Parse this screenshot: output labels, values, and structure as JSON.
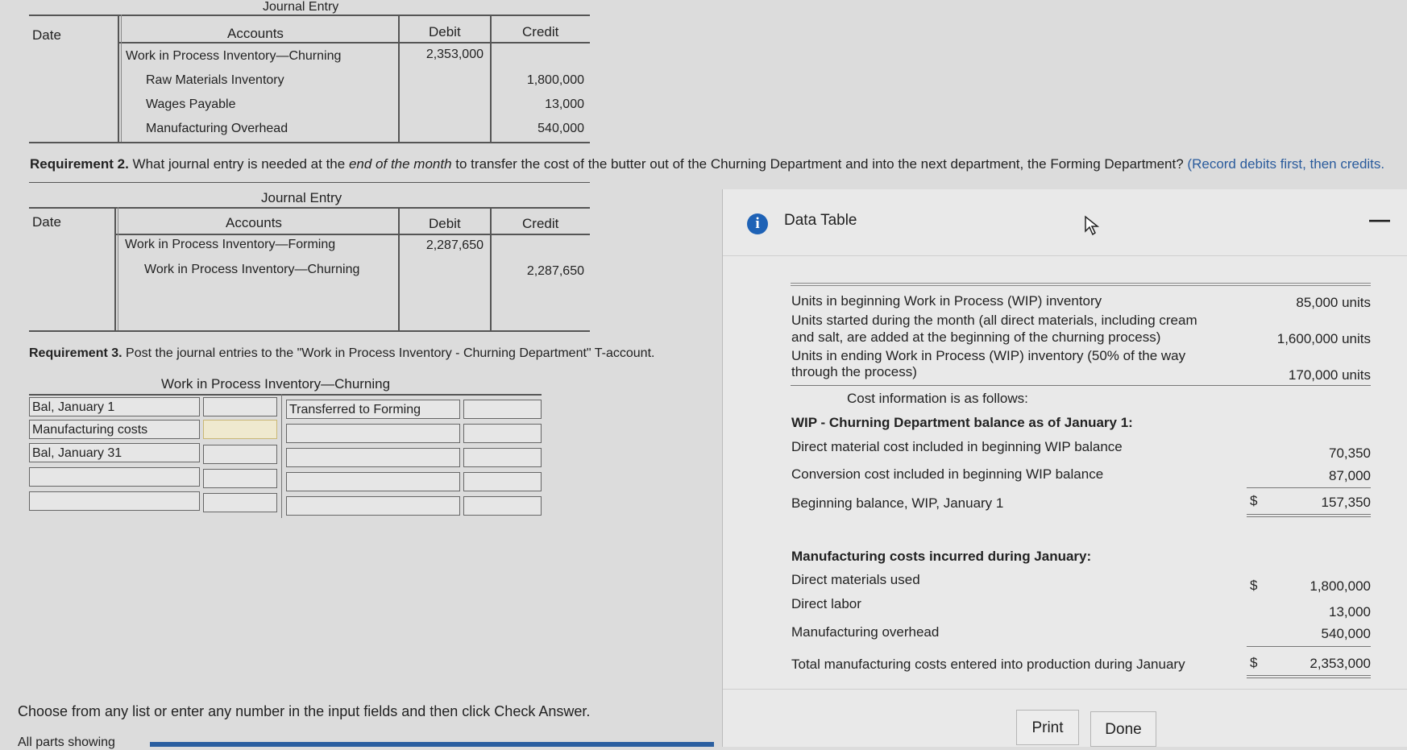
{
  "journal1": {
    "title": "Journal Entry",
    "headers": {
      "date": "Date",
      "accounts": "Accounts",
      "debit": "Debit",
      "credit": "Credit"
    },
    "rows": [
      {
        "account": "Work in Process Inventory—Churning",
        "debit": "2,353,000",
        "credit": ""
      },
      {
        "account": "Raw Materials Inventory",
        "debit": "",
        "credit": "1,800,000"
      },
      {
        "account": "Wages Payable",
        "debit": "",
        "credit": "13,000"
      },
      {
        "account": "Manufacturing Overhead",
        "debit": "",
        "credit": "540,000"
      }
    ]
  },
  "req2": {
    "label": "Requirement 2.",
    "text_a": "What journal entry is needed at the",
    "text_italic": "end of the month",
    "text_b": "to transfer the cost of the butter out of the Churning Department and into the next department, the Forming Department?",
    "hint": "(Record debits first, then credits."
  },
  "journal2": {
    "title": "Journal Entry",
    "headers": {
      "date": "Date",
      "accounts": "Accounts",
      "debit": "Debit",
      "credit": "Credit"
    },
    "rows": [
      {
        "account": "Work in Process Inventory—Forming",
        "debit": "2,287,650",
        "credit": ""
      },
      {
        "account": "Work in Process Inventory—Churning",
        "debit": "",
        "credit": "2,287,650"
      }
    ]
  },
  "req3": {
    "label": "Requirement 3.",
    "text": "Post the journal entries to the \"Work in Process Inventory - Churning Department\" T-account."
  },
  "taccount": {
    "title": "Work in Process Inventory—Churning",
    "left_labels": [
      "Bal, January 1",
      "Manufacturing costs",
      "Bal, January 31"
    ],
    "right_labels": [
      "Transferred to Forming"
    ]
  },
  "footer": {
    "instruction": "Choose from any list or enter any number in the input fields and then click Check Answer.",
    "cut_text": "All parts showing"
  },
  "data_table": {
    "title": "Data Table",
    "info_icon": "i",
    "minimize_icon": "—",
    "units": [
      {
        "label": "Units in beginning Work in Process (WIP) inventory",
        "value": "85,000 units"
      },
      {
        "label": "Units started during the month (all direct materials, including cream and salt, are added at the beginning of the churning process)",
        "value": "1,600,000 units"
      },
      {
        "label": "Units in ending Work in Process (WIP) inventory (50% of the way through the process)",
        "value": "170,000 units"
      }
    ],
    "cost_info": "Cost information is as follows:",
    "wip_header": "WIP - Churning Department balance as of January 1:",
    "wip_rows": [
      {
        "label": "Direct material cost included in beginning WIP balance",
        "value": "70,350"
      },
      {
        "label": "Conversion cost included in beginning WIP balance",
        "value": "87,000"
      },
      {
        "label": "Beginning balance, WIP, January 1",
        "currency": "$",
        "value": "157,350"
      }
    ],
    "mfg_header": "Manufacturing costs incurred during January:",
    "mfg_rows": [
      {
        "label": "Direct materials used",
        "currency": "$",
        "value": "1,800,000"
      },
      {
        "label": "Direct labor",
        "value": "13,000"
      },
      {
        "label": "Manufacturing overhead",
        "value": "540,000"
      },
      {
        "label": "Total manufacturing costs entered into production during January",
        "currency": "$",
        "value": "2,353,000"
      }
    ],
    "print_label": "Print",
    "done_label": "Done"
  }
}
